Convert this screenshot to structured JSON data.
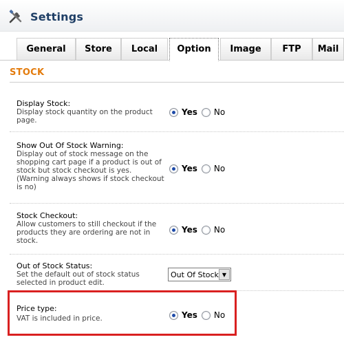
{
  "header": {
    "title": "Settings",
    "icon": "tools-icon"
  },
  "tabs": [
    {
      "label": "General",
      "active": false
    },
    {
      "label": "Store",
      "active": false
    },
    {
      "label": "Local",
      "active": false
    },
    {
      "label": "Option",
      "active": true
    },
    {
      "label": "Image",
      "active": false
    },
    {
      "label": "FTP",
      "active": false
    },
    {
      "label": "Mail",
      "active": false
    }
  ],
  "section": {
    "title": "STOCK"
  },
  "settings": [
    {
      "label": "Display Stock:",
      "desc": "Display stock quantity on the product page.",
      "yes": "Yes",
      "no": "No",
      "value": "Yes"
    },
    {
      "label": "Show Out Of Stock Warning:",
      "desc": "Display out of stock message on the shopping cart page if a product is out of stock but stock checkout is yes. (Warning always shows if stock checkout is no)",
      "yes": "Yes",
      "no": "No",
      "value": "Yes"
    },
    {
      "label": "Stock Checkout:",
      "desc": "Allow customers to still checkout if the products they are ordering are not in stock.",
      "yes": "Yes",
      "no": "No",
      "value": "Yes"
    },
    {
      "label": "Out of Stock Status:",
      "desc": "Set the default out of stock status selected in product edit.",
      "select_value": "Out Of Stock"
    },
    {
      "label": "Price type:",
      "desc": "VAT is included in price.",
      "yes": "Yes",
      "no": "No",
      "value": "Yes"
    }
  ],
  "colors": {
    "section_title": "#e37b0c",
    "header_title": "#1f3f66",
    "highlight": "#d92020"
  }
}
